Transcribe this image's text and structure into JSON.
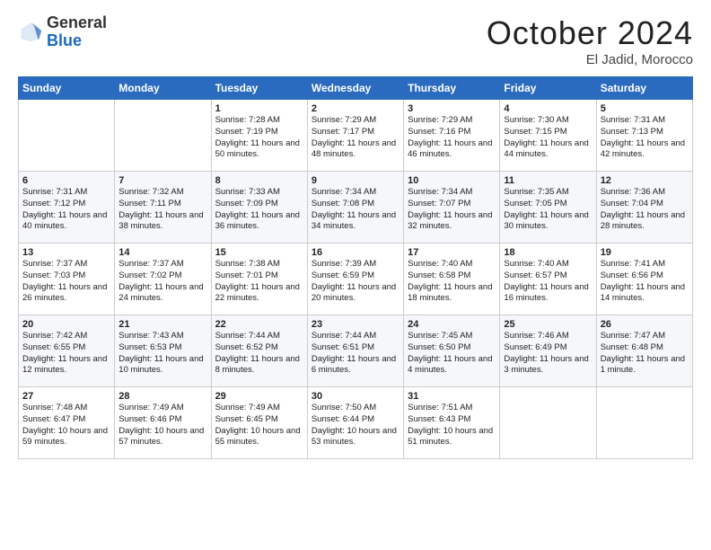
{
  "header": {
    "logo_general": "General",
    "logo_blue": "Blue",
    "month_title": "October 2024",
    "location": "El Jadid, Morocco"
  },
  "days_of_week": [
    "Sunday",
    "Monday",
    "Tuesday",
    "Wednesday",
    "Thursday",
    "Friday",
    "Saturday"
  ],
  "weeks": [
    [
      {
        "day": "",
        "info": ""
      },
      {
        "day": "",
        "info": ""
      },
      {
        "day": "1",
        "info": "Sunrise: 7:28 AM\nSunset: 7:19 PM\nDaylight: 11 hours and 50 minutes."
      },
      {
        "day": "2",
        "info": "Sunrise: 7:29 AM\nSunset: 7:17 PM\nDaylight: 11 hours and 48 minutes."
      },
      {
        "day": "3",
        "info": "Sunrise: 7:29 AM\nSunset: 7:16 PM\nDaylight: 11 hours and 46 minutes."
      },
      {
        "day": "4",
        "info": "Sunrise: 7:30 AM\nSunset: 7:15 PM\nDaylight: 11 hours and 44 minutes."
      },
      {
        "day": "5",
        "info": "Sunrise: 7:31 AM\nSunset: 7:13 PM\nDaylight: 11 hours and 42 minutes."
      }
    ],
    [
      {
        "day": "6",
        "info": "Sunrise: 7:31 AM\nSunset: 7:12 PM\nDaylight: 11 hours and 40 minutes."
      },
      {
        "day": "7",
        "info": "Sunrise: 7:32 AM\nSunset: 7:11 PM\nDaylight: 11 hours and 38 minutes."
      },
      {
        "day": "8",
        "info": "Sunrise: 7:33 AM\nSunset: 7:09 PM\nDaylight: 11 hours and 36 minutes."
      },
      {
        "day": "9",
        "info": "Sunrise: 7:34 AM\nSunset: 7:08 PM\nDaylight: 11 hours and 34 minutes."
      },
      {
        "day": "10",
        "info": "Sunrise: 7:34 AM\nSunset: 7:07 PM\nDaylight: 11 hours and 32 minutes."
      },
      {
        "day": "11",
        "info": "Sunrise: 7:35 AM\nSunset: 7:05 PM\nDaylight: 11 hours and 30 minutes."
      },
      {
        "day": "12",
        "info": "Sunrise: 7:36 AM\nSunset: 7:04 PM\nDaylight: 11 hours and 28 minutes."
      }
    ],
    [
      {
        "day": "13",
        "info": "Sunrise: 7:37 AM\nSunset: 7:03 PM\nDaylight: 11 hours and 26 minutes."
      },
      {
        "day": "14",
        "info": "Sunrise: 7:37 AM\nSunset: 7:02 PM\nDaylight: 11 hours and 24 minutes."
      },
      {
        "day": "15",
        "info": "Sunrise: 7:38 AM\nSunset: 7:01 PM\nDaylight: 11 hours and 22 minutes."
      },
      {
        "day": "16",
        "info": "Sunrise: 7:39 AM\nSunset: 6:59 PM\nDaylight: 11 hours and 20 minutes."
      },
      {
        "day": "17",
        "info": "Sunrise: 7:40 AM\nSunset: 6:58 PM\nDaylight: 11 hours and 18 minutes."
      },
      {
        "day": "18",
        "info": "Sunrise: 7:40 AM\nSunset: 6:57 PM\nDaylight: 11 hours and 16 minutes."
      },
      {
        "day": "19",
        "info": "Sunrise: 7:41 AM\nSunset: 6:56 PM\nDaylight: 11 hours and 14 minutes."
      }
    ],
    [
      {
        "day": "20",
        "info": "Sunrise: 7:42 AM\nSunset: 6:55 PM\nDaylight: 11 hours and 12 minutes."
      },
      {
        "day": "21",
        "info": "Sunrise: 7:43 AM\nSunset: 6:53 PM\nDaylight: 11 hours and 10 minutes."
      },
      {
        "day": "22",
        "info": "Sunrise: 7:44 AM\nSunset: 6:52 PM\nDaylight: 11 hours and 8 minutes."
      },
      {
        "day": "23",
        "info": "Sunrise: 7:44 AM\nSunset: 6:51 PM\nDaylight: 11 hours and 6 minutes."
      },
      {
        "day": "24",
        "info": "Sunrise: 7:45 AM\nSunset: 6:50 PM\nDaylight: 11 hours and 4 minutes."
      },
      {
        "day": "25",
        "info": "Sunrise: 7:46 AM\nSunset: 6:49 PM\nDaylight: 11 hours and 3 minutes."
      },
      {
        "day": "26",
        "info": "Sunrise: 7:47 AM\nSunset: 6:48 PM\nDaylight: 11 hours and 1 minute."
      }
    ],
    [
      {
        "day": "27",
        "info": "Sunrise: 7:48 AM\nSunset: 6:47 PM\nDaylight: 10 hours and 59 minutes."
      },
      {
        "day": "28",
        "info": "Sunrise: 7:49 AM\nSunset: 6:46 PM\nDaylight: 10 hours and 57 minutes."
      },
      {
        "day": "29",
        "info": "Sunrise: 7:49 AM\nSunset: 6:45 PM\nDaylight: 10 hours and 55 minutes."
      },
      {
        "day": "30",
        "info": "Sunrise: 7:50 AM\nSunset: 6:44 PM\nDaylight: 10 hours and 53 minutes."
      },
      {
        "day": "31",
        "info": "Sunrise: 7:51 AM\nSunset: 6:43 PM\nDaylight: 10 hours and 51 minutes."
      },
      {
        "day": "",
        "info": ""
      },
      {
        "day": "",
        "info": ""
      }
    ]
  ]
}
